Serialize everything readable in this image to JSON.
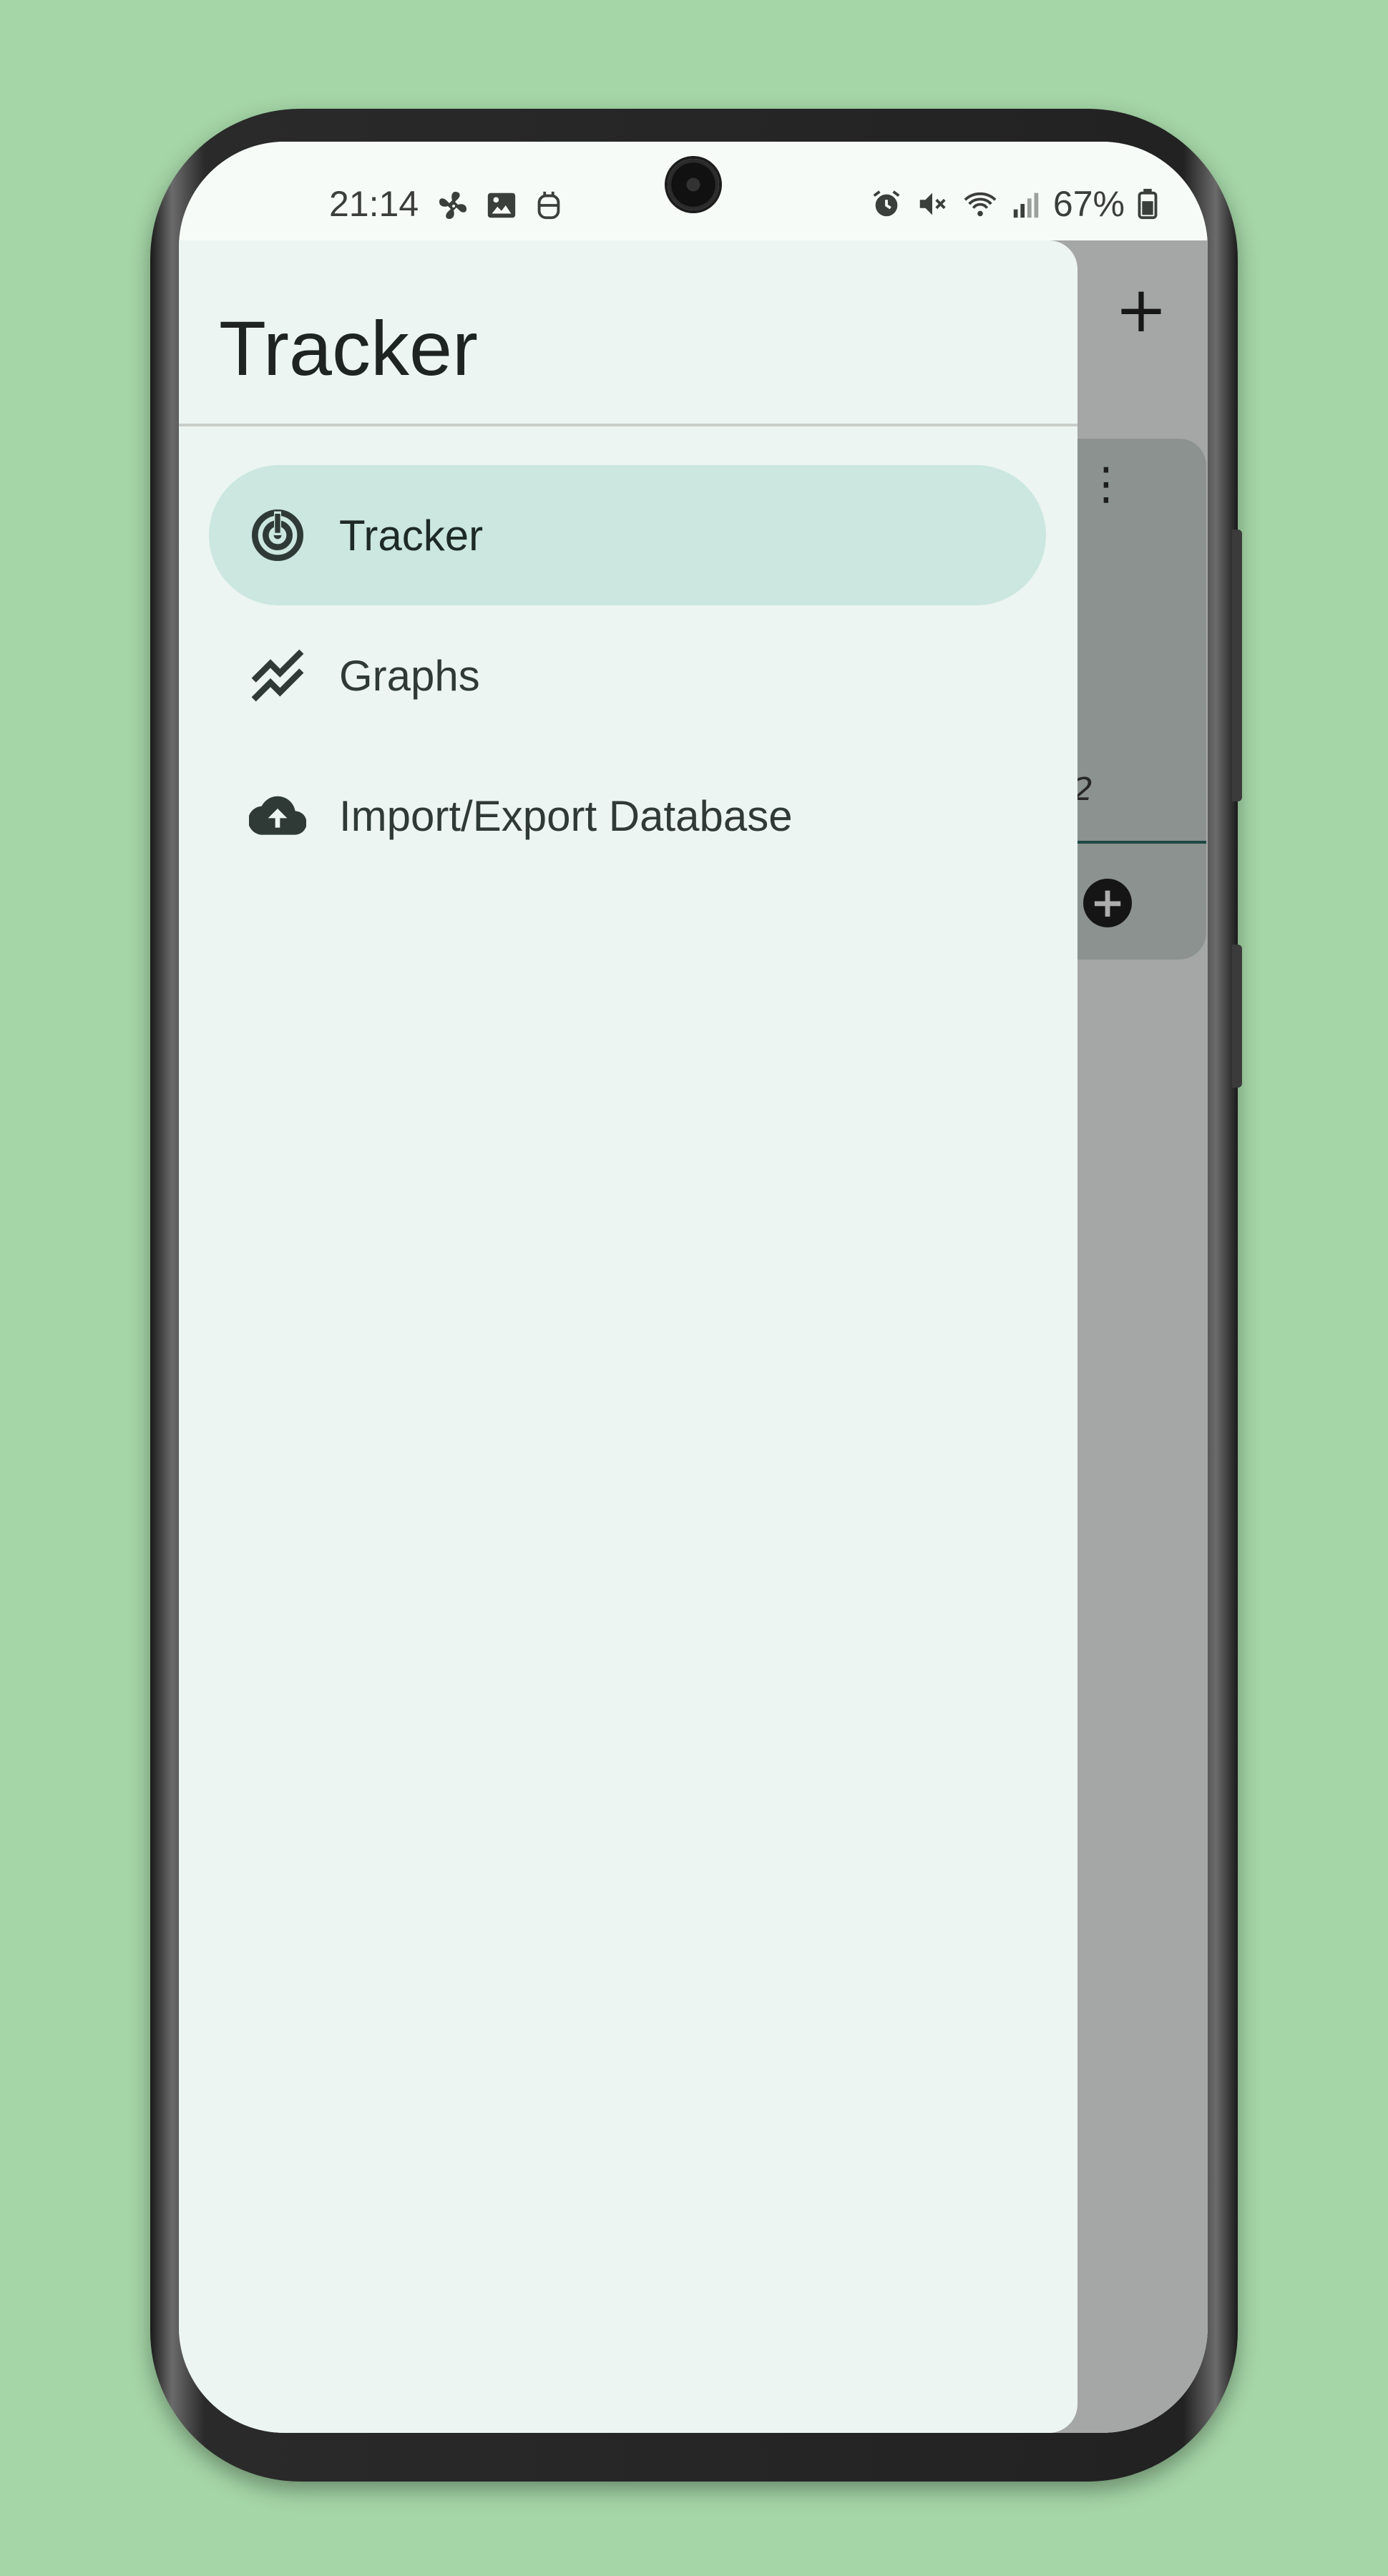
{
  "status_bar": {
    "time": "21:14",
    "left_icons": [
      "fan-icon",
      "image-icon",
      "robot-icon"
    ],
    "right_icons": [
      "alarm-icon",
      "mute-icon",
      "wifi-icon",
      "signal-icon"
    ],
    "battery": "67%"
  },
  "drawer": {
    "title": "Tracker",
    "items": [
      {
        "label": "Tracker",
        "icon": "target-icon",
        "active": true
      },
      {
        "label": "Graphs",
        "icon": "graph-icon",
        "active": false
      },
      {
        "label": "Import/Export Database",
        "icon": "cloud-upload-icon",
        "active": false
      }
    ]
  },
  "background_app": {
    "card_value_partial": "2"
  },
  "colors": {
    "page_background": "#a5d6a7",
    "drawer_background": "#ecf5f1",
    "active_item": "#cbe7df",
    "accent_line": "#2e6b63"
  }
}
